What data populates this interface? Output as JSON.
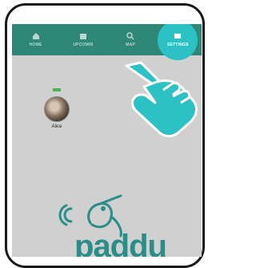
{
  "tabs": [
    {
      "label": "HOME",
      "icon": "home-icon"
    },
    {
      "label": "UPCOMIN",
      "icon": "calendar-icon"
    },
    {
      "label": "MAP",
      "icon": "search-icon"
    },
    {
      "label": "SETTINGS",
      "icon": "settings-icon"
    }
  ],
  "profile": {
    "name": "Alice",
    "status_color": "#4caf50"
  },
  "logo": {
    "text": "paddu"
  },
  "colors": {
    "tabbar": "#2f8777",
    "highlight": "#2cc1c4",
    "brand": "#2a8d87"
  }
}
